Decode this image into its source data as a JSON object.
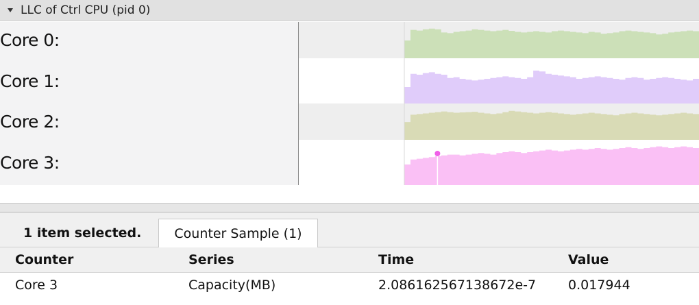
{
  "process": {
    "title": "LLC of Ctrl CPU (pid 0)",
    "expand_icon": "triangle-down-icon"
  },
  "tracks": [
    {
      "label": "Core 0:",
      "color": "#cce0b8",
      "row_bg": "#eeeeee",
      "levels": [
        0.55,
        0.88,
        0.86,
        0.9,
        0.92,
        0.9,
        0.8,
        0.78,
        0.82,
        0.84,
        0.86,
        0.9,
        0.88,
        0.86,
        0.84,
        0.86,
        0.88,
        0.85,
        0.82,
        0.8,
        0.82,
        0.84,
        0.82,
        0.8,
        0.84,
        0.86,
        0.84,
        0.82,
        0.8,
        0.78,
        0.82,
        0.8,
        0.76,
        0.78,
        0.8,
        0.84,
        0.86,
        0.84,
        0.82,
        0.8,
        0.78,
        0.74,
        0.76,
        0.8,
        0.82,
        0.84,
        0.86,
        0.84
      ]
    },
    {
      "label": "Core 1:",
      "color": "#e0ccfa",
      "row_bg": "#ffffff",
      "levels": [
        0.4,
        0.72,
        0.7,
        0.74,
        0.76,
        0.72,
        0.7,
        0.62,
        0.64,
        0.6,
        0.58,
        0.56,
        0.58,
        0.6,
        0.62,
        0.64,
        0.66,
        0.64,
        0.62,
        0.6,
        0.64,
        0.8,
        0.78,
        0.72,
        0.7,
        0.68,
        0.66,
        0.64,
        0.6,
        0.62,
        0.64,
        0.66,
        0.64,
        0.62,
        0.6,
        0.58,
        0.62,
        0.64,
        0.62,
        0.58,
        0.6,
        0.62,
        0.64,
        0.62,
        0.6,
        0.58,
        0.56,
        0.6
      ]
    },
    {
      "label": "Core 2:",
      "color": "#d9dbb6",
      "row_bg": "#eeeeee",
      "levels": [
        0.55,
        0.78,
        0.8,
        0.82,
        0.84,
        0.86,
        0.88,
        0.86,
        0.84,
        0.85,
        0.86,
        0.87,
        0.84,
        0.82,
        0.8,
        0.82,
        0.86,
        0.9,
        0.88,
        0.86,
        0.84,
        0.82,
        0.84,
        0.86,
        0.84,
        0.82,
        0.8,
        0.78,
        0.8,
        0.82,
        0.84,
        0.82,
        0.8,
        0.78,
        0.76,
        0.8,
        0.82,
        0.84,
        0.82,
        0.8,
        0.78,
        0.76,
        0.78,
        0.8,
        0.82,
        0.84,
        0.82,
        0.8
      ]
    },
    {
      "label": "Core 3:",
      "color": "#fac0f5",
      "row_bg": "#ffffff",
      "levels": [
        0.5,
        0.62,
        0.64,
        0.66,
        0.68,
        0.7,
        0.72,
        0.74,
        0.74,
        0.72,
        0.74,
        0.76,
        0.78,
        0.76,
        0.74,
        0.78,
        0.8,
        0.82,
        0.8,
        0.78,
        0.8,
        0.82,
        0.84,
        0.86,
        0.84,
        0.82,
        0.84,
        0.86,
        0.88,
        0.86,
        0.88,
        0.9,
        0.88,
        0.86,
        0.88,
        0.9,
        0.92,
        0.9,
        0.88,
        0.9,
        0.92,
        0.94,
        0.92,
        0.9,
        0.92,
        0.94,
        0.92,
        0.9
      ],
      "selected_marker": true,
      "marker_color": "#f060e8"
    }
  ],
  "selection": {
    "summary": "1 item selected.",
    "tab_label": "Counter Sample (1)"
  },
  "table": {
    "columns": [
      "Counter",
      "Series",
      "Time",
      "Value"
    ],
    "rows": [
      [
        "Core 3",
        "Capacity(MB)",
        "2.086162567138672e-7",
        "0.017944"
      ]
    ]
  }
}
